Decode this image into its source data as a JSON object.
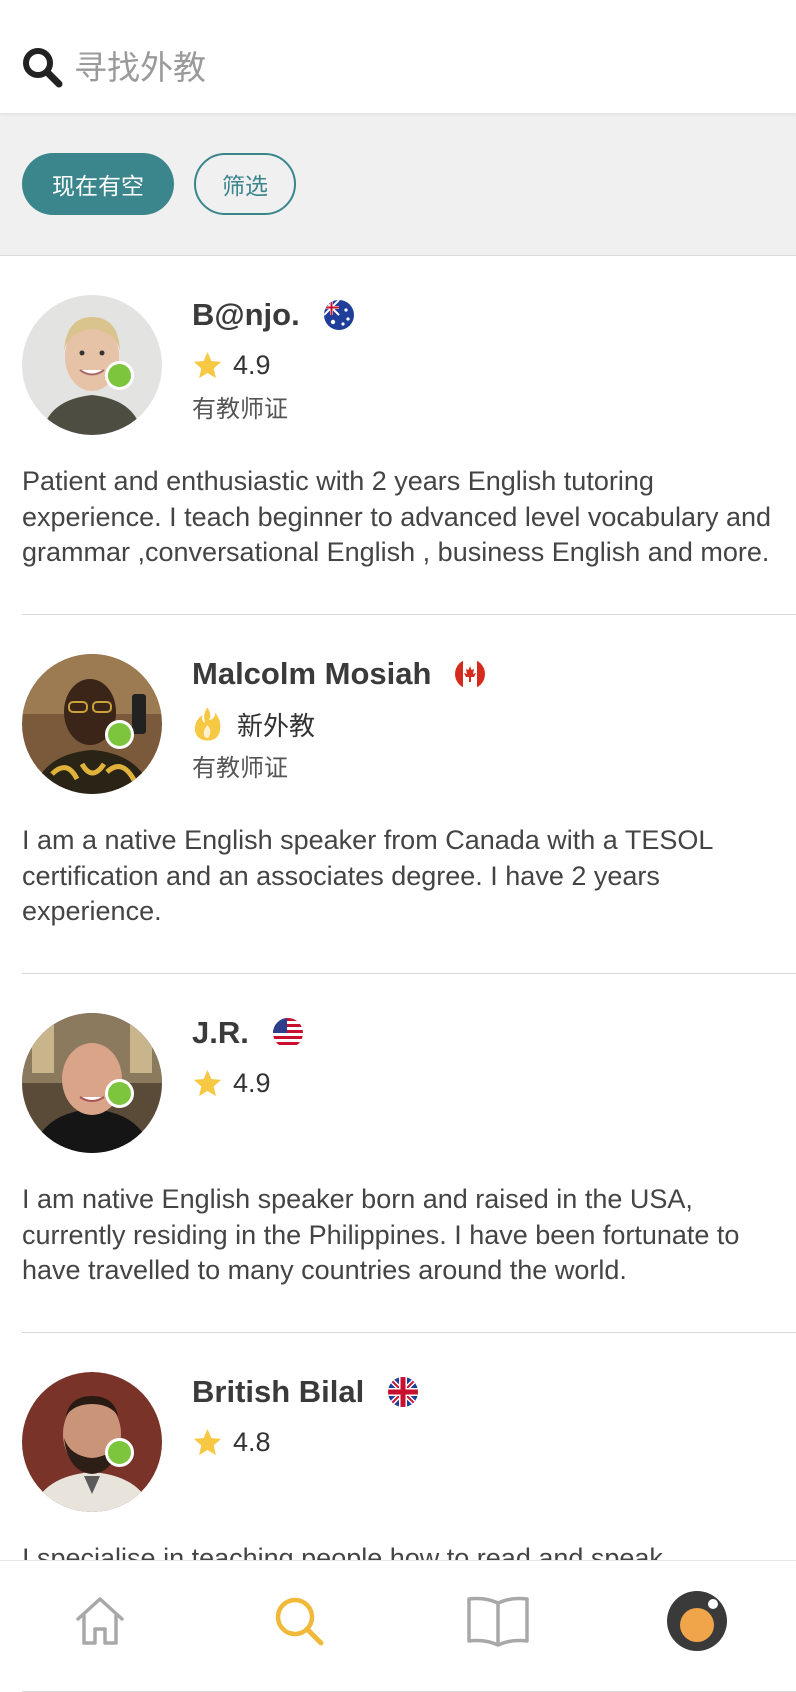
{
  "search": {
    "placeholder": "寻找外教",
    "icon": "search-icon"
  },
  "filters": {
    "available_now": "现在有空",
    "filter": "筛选",
    "accent_color": "#3b858c"
  },
  "tutors": [
    {
      "name": "B@njo.",
      "country_flag": "australia-flag-icon",
      "rating": "4.9",
      "certified": "有教师证",
      "online": true,
      "description": "Patient and enthusiastic with 2 years English tutoring experience. I teach beginner to advanced level vocabulary and grammar ,conversational English , business English and more."
    },
    {
      "name": "Malcolm Mosiah",
      "country_flag": "canada-flag-icon",
      "new_label": "新外教",
      "certified": "有教师证",
      "online": true,
      "description": "I am a native English speaker from Canada with a TESOL certification and an associates degree. I have 2 years experience."
    },
    {
      "name": "J.R.",
      "country_flag": "usa-flag-icon",
      "rating": "4.9",
      "online": true,
      "description": "I am native English speaker born and raised in the USA, currently residing in the Philippines. I have been fortunate to have travelled to many countries around the world."
    },
    {
      "name": "British Bilal",
      "country_flag": "uk-flag-icon",
      "rating": "4.8",
      "online": true,
      "description": "I specialise in teaching people how to read and speak"
    }
  ],
  "colors": {
    "online": "#7cc53d",
    "star": "#f7c843",
    "active_tab": "#f0b93a",
    "inactive_tab": "#a8a8a8"
  },
  "tabs": [
    {
      "icon": "home-icon",
      "active": false
    },
    {
      "icon": "search-icon",
      "active": true
    },
    {
      "icon": "book-icon",
      "active": false
    },
    {
      "icon": "profile-icon",
      "active": false
    }
  ]
}
